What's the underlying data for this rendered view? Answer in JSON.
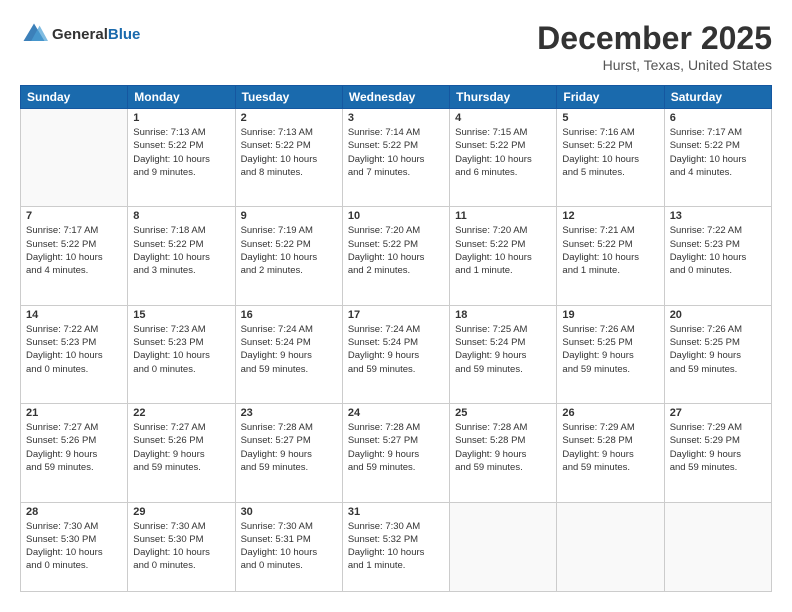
{
  "header": {
    "logo_general": "General",
    "logo_blue": "Blue",
    "month": "December 2025",
    "location": "Hurst, Texas, United States"
  },
  "weekdays": [
    "Sunday",
    "Monday",
    "Tuesday",
    "Wednesday",
    "Thursday",
    "Friday",
    "Saturday"
  ],
  "weeks": [
    [
      {
        "day": "",
        "info": ""
      },
      {
        "day": "1",
        "info": "Sunrise: 7:13 AM\nSunset: 5:22 PM\nDaylight: 10 hours\nand 9 minutes."
      },
      {
        "day": "2",
        "info": "Sunrise: 7:13 AM\nSunset: 5:22 PM\nDaylight: 10 hours\nand 8 minutes."
      },
      {
        "day": "3",
        "info": "Sunrise: 7:14 AM\nSunset: 5:22 PM\nDaylight: 10 hours\nand 7 minutes."
      },
      {
        "day": "4",
        "info": "Sunrise: 7:15 AM\nSunset: 5:22 PM\nDaylight: 10 hours\nand 6 minutes."
      },
      {
        "day": "5",
        "info": "Sunrise: 7:16 AM\nSunset: 5:22 PM\nDaylight: 10 hours\nand 5 minutes."
      },
      {
        "day": "6",
        "info": "Sunrise: 7:17 AM\nSunset: 5:22 PM\nDaylight: 10 hours\nand 4 minutes."
      }
    ],
    [
      {
        "day": "7",
        "info": "Sunrise: 7:17 AM\nSunset: 5:22 PM\nDaylight: 10 hours\nand 4 minutes."
      },
      {
        "day": "8",
        "info": "Sunrise: 7:18 AM\nSunset: 5:22 PM\nDaylight: 10 hours\nand 3 minutes."
      },
      {
        "day": "9",
        "info": "Sunrise: 7:19 AM\nSunset: 5:22 PM\nDaylight: 10 hours\nand 2 minutes."
      },
      {
        "day": "10",
        "info": "Sunrise: 7:20 AM\nSunset: 5:22 PM\nDaylight: 10 hours\nand 2 minutes."
      },
      {
        "day": "11",
        "info": "Sunrise: 7:20 AM\nSunset: 5:22 PM\nDaylight: 10 hours\nand 1 minute."
      },
      {
        "day": "12",
        "info": "Sunrise: 7:21 AM\nSunset: 5:22 PM\nDaylight: 10 hours\nand 1 minute."
      },
      {
        "day": "13",
        "info": "Sunrise: 7:22 AM\nSunset: 5:23 PM\nDaylight: 10 hours\nand 0 minutes."
      }
    ],
    [
      {
        "day": "14",
        "info": "Sunrise: 7:22 AM\nSunset: 5:23 PM\nDaylight: 10 hours\nand 0 minutes."
      },
      {
        "day": "15",
        "info": "Sunrise: 7:23 AM\nSunset: 5:23 PM\nDaylight: 10 hours\nand 0 minutes."
      },
      {
        "day": "16",
        "info": "Sunrise: 7:24 AM\nSunset: 5:24 PM\nDaylight: 9 hours\nand 59 minutes."
      },
      {
        "day": "17",
        "info": "Sunrise: 7:24 AM\nSunset: 5:24 PM\nDaylight: 9 hours\nand 59 minutes."
      },
      {
        "day": "18",
        "info": "Sunrise: 7:25 AM\nSunset: 5:24 PM\nDaylight: 9 hours\nand 59 minutes."
      },
      {
        "day": "19",
        "info": "Sunrise: 7:26 AM\nSunset: 5:25 PM\nDaylight: 9 hours\nand 59 minutes."
      },
      {
        "day": "20",
        "info": "Sunrise: 7:26 AM\nSunset: 5:25 PM\nDaylight: 9 hours\nand 59 minutes."
      }
    ],
    [
      {
        "day": "21",
        "info": "Sunrise: 7:27 AM\nSunset: 5:26 PM\nDaylight: 9 hours\nand 59 minutes."
      },
      {
        "day": "22",
        "info": "Sunrise: 7:27 AM\nSunset: 5:26 PM\nDaylight: 9 hours\nand 59 minutes."
      },
      {
        "day": "23",
        "info": "Sunrise: 7:28 AM\nSunset: 5:27 PM\nDaylight: 9 hours\nand 59 minutes."
      },
      {
        "day": "24",
        "info": "Sunrise: 7:28 AM\nSunset: 5:27 PM\nDaylight: 9 hours\nand 59 minutes."
      },
      {
        "day": "25",
        "info": "Sunrise: 7:28 AM\nSunset: 5:28 PM\nDaylight: 9 hours\nand 59 minutes."
      },
      {
        "day": "26",
        "info": "Sunrise: 7:29 AM\nSunset: 5:28 PM\nDaylight: 9 hours\nand 59 minutes."
      },
      {
        "day": "27",
        "info": "Sunrise: 7:29 AM\nSunset: 5:29 PM\nDaylight: 9 hours\nand 59 minutes."
      }
    ],
    [
      {
        "day": "28",
        "info": "Sunrise: 7:30 AM\nSunset: 5:30 PM\nDaylight: 10 hours\nand 0 minutes."
      },
      {
        "day": "29",
        "info": "Sunrise: 7:30 AM\nSunset: 5:30 PM\nDaylight: 10 hours\nand 0 minutes."
      },
      {
        "day": "30",
        "info": "Sunrise: 7:30 AM\nSunset: 5:31 PM\nDaylight: 10 hours\nand 0 minutes."
      },
      {
        "day": "31",
        "info": "Sunrise: 7:30 AM\nSunset: 5:32 PM\nDaylight: 10 hours\nand 1 minute."
      },
      {
        "day": "",
        "info": ""
      },
      {
        "day": "",
        "info": ""
      },
      {
        "day": "",
        "info": ""
      }
    ]
  ]
}
